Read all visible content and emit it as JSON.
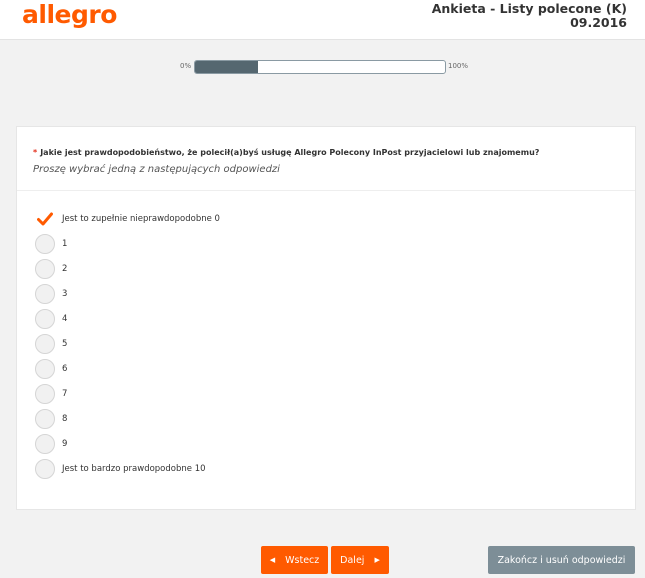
{
  "header": {
    "logo_text": "allegro",
    "survey_title_line1": "Ankieta - Listy polecone (K)",
    "survey_title_line2": "09.2016"
  },
  "progress": {
    "min_label": "0%",
    "max_label": "100%",
    "value_percent": 25,
    "fill_color": "#556770"
  },
  "question": {
    "required_marker": "*",
    "text": "Jakie jest prawdopodobieństwo, że polecił(a)byś usługę Allegro Polecony InPost przyjacielowi lub znajomemu?",
    "instruction": "Proszę wybrać jedną z następujących odpowiedzi",
    "options": [
      {
        "label": "Jest to zupełnie nieprawdopodobne 0",
        "checked": true
      },
      {
        "label": "1",
        "checked": false
      },
      {
        "label": "2",
        "checked": false
      },
      {
        "label": "3",
        "checked": false
      },
      {
        "label": "4",
        "checked": false
      },
      {
        "label": "5",
        "checked": false
      },
      {
        "label": "6",
        "checked": false
      },
      {
        "label": "7",
        "checked": false
      },
      {
        "label": "8",
        "checked": false
      },
      {
        "label": "9",
        "checked": false
      },
      {
        "label": "Jest to bardzo prawdopodobne 10",
        "checked": false
      }
    ]
  },
  "buttons": {
    "back_label": "Wstecz",
    "back_icon": "chevron-left-icon",
    "next_label": "Dalej",
    "next_icon": "chevron-right-icon",
    "finish_label": "Zakończ i usuń odpowiedzi"
  },
  "colors": {
    "brand": "#ff5a00",
    "secondary_button": "#7d8e97",
    "required": "#e4301d"
  }
}
